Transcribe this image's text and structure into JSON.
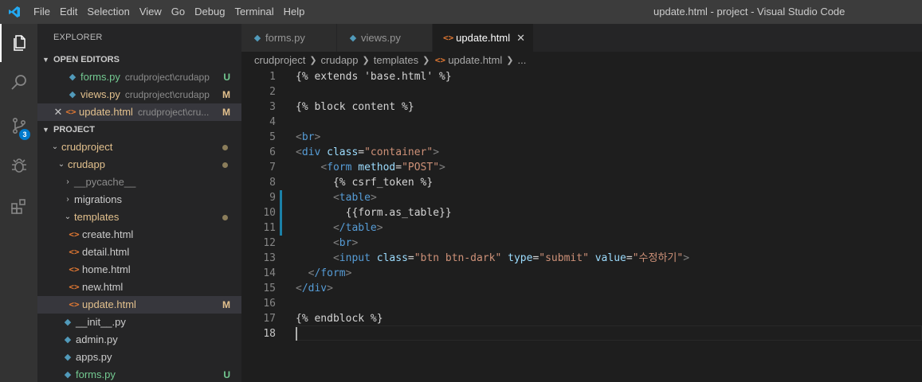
{
  "window": {
    "title": "update.html - project - Visual Studio Code"
  },
  "menu": [
    "File",
    "Edit",
    "Selection",
    "View",
    "Go",
    "Debug",
    "Terminal",
    "Help"
  ],
  "activity": {
    "scm_badge": "3"
  },
  "explorer": {
    "header": "EXPLORER",
    "open_editors_label": "OPEN EDITORS",
    "open_editors": [
      {
        "name": "forms.py",
        "path": "crudproject\\crudapp",
        "status": "U"
      },
      {
        "name": "views.py",
        "path": "crudproject\\crudapp",
        "status": "M"
      },
      {
        "name": "update.html",
        "path": "crudproject\\cru...",
        "status": "M"
      }
    ],
    "project_label": "PROJECT",
    "tree": {
      "crudproject": "crudproject",
      "crudapp": "crudapp",
      "pycache": "__pycache__",
      "migrations": "migrations",
      "templates": "templates",
      "templates_files": [
        "create.html",
        "detail.html",
        "home.html",
        "new.html",
        "update.html"
      ],
      "update_status": "M",
      "py_files": [
        "__init__.py",
        "admin.py",
        "apps.py",
        "forms.py"
      ],
      "forms_status": "U"
    }
  },
  "tabs": [
    {
      "label": "forms.py"
    },
    {
      "label": "views.py"
    },
    {
      "label": "update.html"
    }
  ],
  "breadcrumb": [
    "crudproject",
    "crudapp",
    "templates",
    "update.html",
    "..."
  ],
  "colors": {
    "accent": "#007acc",
    "modified": "#e2c08d",
    "untracked": "#73c991"
  },
  "code": {
    "l1": "{% extends 'base.html' %}",
    "l3": "{% block content %}",
    "l5_tag": "br",
    "l6_tag": "div",
    "l6_attr": "class",
    "l6_val": "\"container\"",
    "l7_tag": "form",
    "l7_attr": "method",
    "l7_val": "\"POST\"",
    "l8": "{% csrf_token %}",
    "l9_tag": "table",
    "l10": "{{form.as_table}}",
    "l11_tag": "/table",
    "l12_tag": "br",
    "l13_tag": "input",
    "l13_a1": "class",
    "l13_v1": "\"btn btn-dark\"",
    "l13_a2": "type",
    "l13_v2": "\"submit\"",
    "l13_a3": "value",
    "l13_v3": "\"수정하기\"",
    "l14_tag": "/form",
    "l15_tag": "/div",
    "l17": "{% endblock %}"
  },
  "line_numbers": [
    "1",
    "2",
    "3",
    "4",
    "5",
    "6",
    "7",
    "8",
    "9",
    "10",
    "11",
    "12",
    "13",
    "14",
    "15",
    "16",
    "17",
    "18"
  ]
}
